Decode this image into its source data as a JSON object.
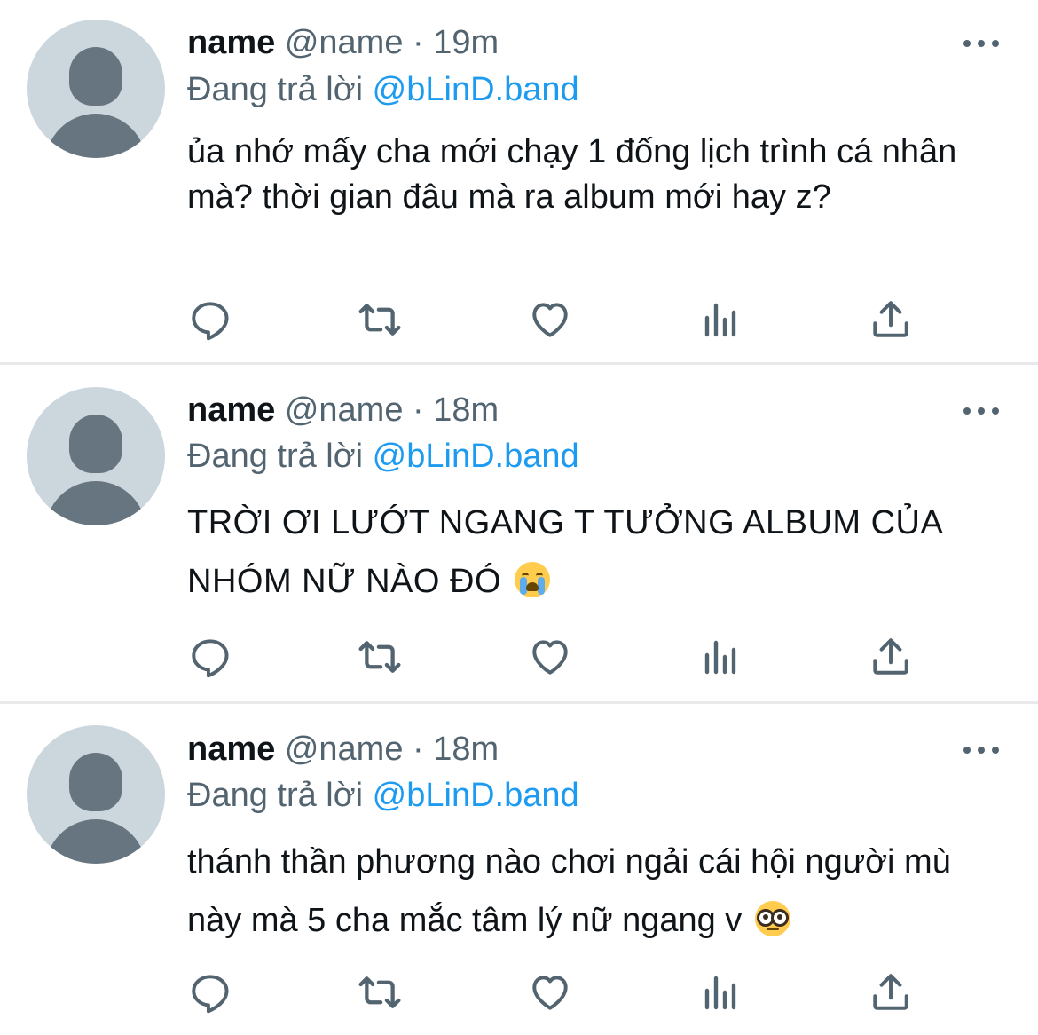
{
  "tweets": [
    {
      "display_name": "name",
      "handle": "@name",
      "separator": "·",
      "time": "19m",
      "reply_prefix": "Đang trả lời",
      "reply_to": "@bLinD.band",
      "text": "ủa nhớ mấy cha mới chạy 1 đống lịch trình cá nhân mà? thời gian đâu mà ra album mới hay z?",
      "emoji": ""
    },
    {
      "display_name": "name",
      "handle": "@name",
      "separator": "·",
      "time": "18m",
      "reply_prefix": "Đang trả lời",
      "reply_to": "@bLinD.band",
      "text": "TRỜI ƠI LƯỚT NGANG T TƯỞNG ALBUM CỦA NHÓM NỮ NÀO ĐÓ",
      "emoji": "loudly-crying-face"
    },
    {
      "display_name": "name",
      "handle": "@name",
      "separator": "·",
      "time": "18m",
      "reply_prefix": "Đang trả lời",
      "reply_to": "@bLinD.band",
      "text": "thánh thần phương nào chơi ngải cái hội người mù này mà 5 cha mắc tâm lý nữ ngang v",
      "emoji": "nerd-face"
    }
  ],
  "actions": [
    "reply-icon",
    "retweet-icon",
    "like-icon",
    "views-icon",
    "share-icon"
  ],
  "colors": {
    "avatar_bg": "#ccd6dd",
    "avatar_fg": "#66757f",
    "text": "#0f1419",
    "muted": "#536471",
    "accent": "#1d9bf0",
    "divider": "#e7e9ea"
  }
}
